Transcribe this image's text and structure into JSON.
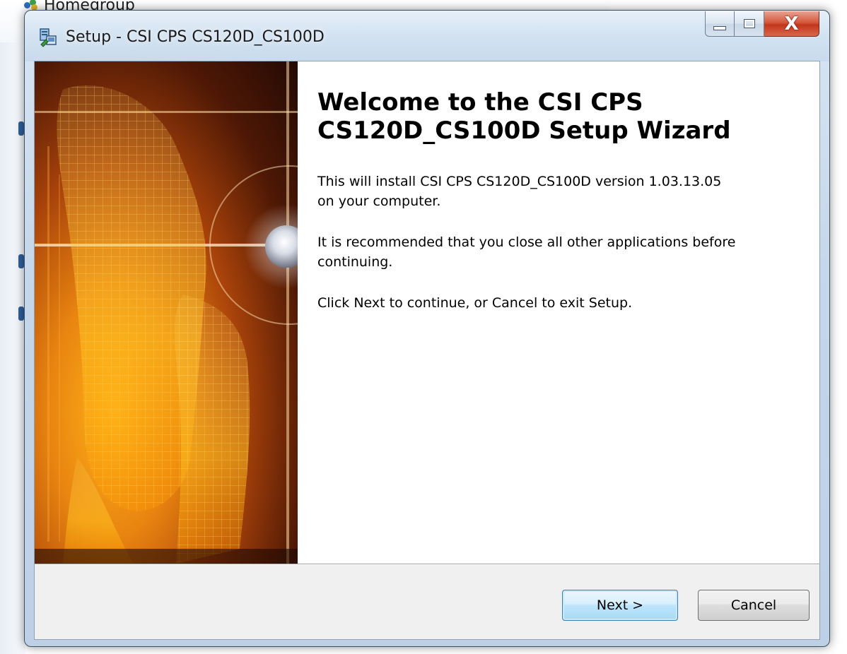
{
  "background": {
    "explorer_item_label": "Homegroup"
  },
  "window": {
    "title": "Setup - CSI CPS CS120D_CS100D",
    "caption": {
      "minimize_icon": "minimize-icon",
      "maximize_icon": "maximize-icon",
      "close_glyph": "X"
    }
  },
  "wizard": {
    "heading_line1": "Welcome to the CSI CPS",
    "heading_line2": "CS120D_CS100D Setup Wizard",
    "para1_line1": "This will install CSI CPS CS120D_CS100D version 1.03.13.05",
    "para1_line2": "on your computer.",
    "para2_line1": "It is recommended that you close all other applications before",
    "para2_line2": "continuing.",
    "para3": "Click Next to continue, or Cancel to exit Setup."
  },
  "buttons": {
    "next_label": "Next >",
    "cancel_label": "Cancel"
  },
  "colors": {
    "accent": "#3c7fb1",
    "banner_glow": "#ffb21a",
    "close_red": "#c3361b"
  }
}
